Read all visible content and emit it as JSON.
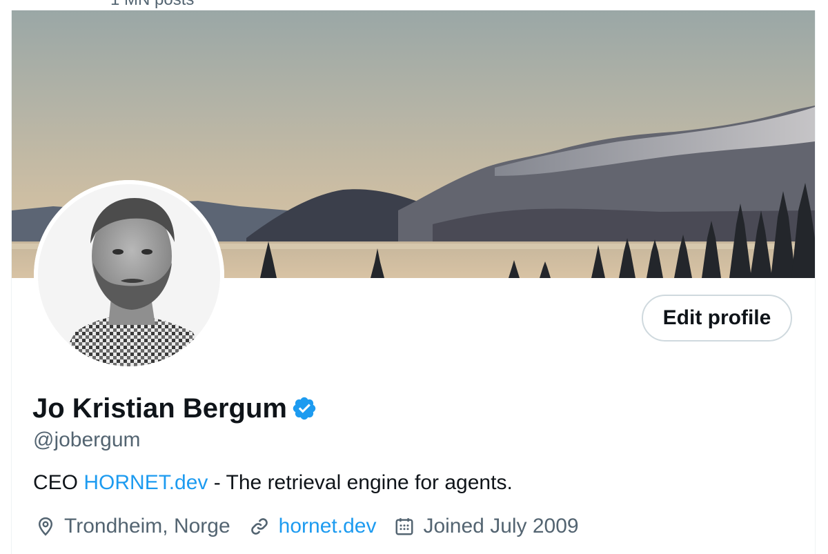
{
  "header": {
    "post_count": "1 MN posts"
  },
  "profile": {
    "display_name": "Jo Kristian Bergum",
    "handle": "@jobergum",
    "edit_button_label": "Edit profile",
    "bio": {
      "prefix": "CEO",
      "link_text": "HORNET.dev",
      "suffix": "- The retrieval engine for agents."
    },
    "location": "Trondheim, Norge",
    "website": "hornet.dev",
    "joined": "Joined July 2009"
  },
  "icons": {
    "verified": "verified-badge-icon",
    "location": "location-pin-icon",
    "link": "link-icon",
    "calendar": "calendar-icon"
  },
  "colors": {
    "accent": "#1d9bf0",
    "text_primary": "#0f1419",
    "text_secondary": "#536471",
    "border": "#cfd9de",
    "verified": "#1d9bf0"
  }
}
